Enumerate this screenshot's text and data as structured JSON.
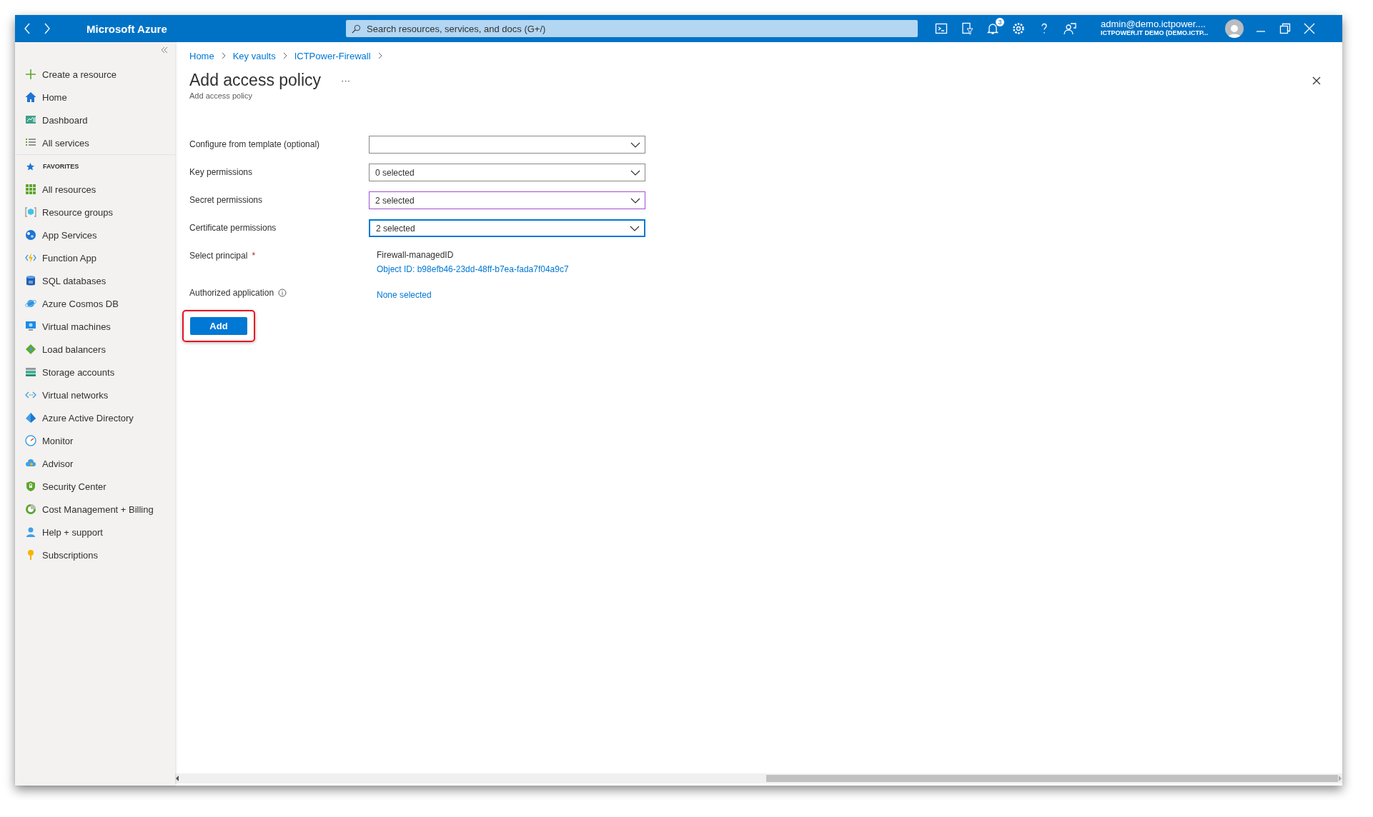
{
  "top_bar": {
    "brand": "Microsoft Azure",
    "search": {
      "placeholder": "Search resources, services, and docs (G+/)"
    },
    "notification_count": "3",
    "account": {
      "email": "admin@demo.ictpower....",
      "directory": "ICTPOWER.IT DEMO (DEMO.ICTP..."
    }
  },
  "sidebar": {
    "items": [
      {
        "kind": "plus",
        "label": "Create a resource"
      },
      {
        "kind": "home",
        "label": "Home"
      },
      {
        "kind": "dashboard",
        "label": "Dashboard"
      },
      {
        "kind": "list",
        "label": "All services"
      }
    ],
    "favorites_label": "FAVORITES",
    "favorites": [
      {
        "kind": "grid",
        "label": "All resources"
      },
      {
        "kind": "cube",
        "label": "Resource groups"
      },
      {
        "kind": "globe",
        "label": "App Services"
      },
      {
        "kind": "bolt",
        "label": "Function App"
      },
      {
        "kind": "sql",
        "label": "SQL databases"
      },
      {
        "kind": "planet",
        "label": "Azure Cosmos DB"
      },
      {
        "kind": "monitor",
        "label": "Virtual machines"
      },
      {
        "kind": "diamond",
        "label": "Load balancers"
      },
      {
        "kind": "storage",
        "label": "Storage accounts"
      },
      {
        "kind": "code",
        "label": "Virtual networks"
      },
      {
        "kind": "pyramid",
        "label": "Azure Active Directory"
      },
      {
        "kind": "gauge",
        "label": "Monitor"
      },
      {
        "kind": "cloud",
        "label": "Advisor"
      },
      {
        "kind": "shield",
        "label": "Security Center"
      },
      {
        "kind": "coin",
        "label": "Cost Management + Billing"
      },
      {
        "kind": "person",
        "label": "Help + support"
      },
      {
        "kind": "key",
        "label": "Subscriptions"
      }
    ]
  },
  "breadcrumb": [
    "Home",
    "Key vaults",
    "ICTPower-Firewall"
  ],
  "title": "Add access policy",
  "more_button": "···",
  "subtitle": "Add access policy",
  "form": [
    {
      "kind": "dropdown",
      "label": "Configure from template (optional)",
      "hovered": false,
      "focused": false
    },
    {
      "kind": "dropdown",
      "label": "Key permissions",
      "value": "0 selected",
      "hovered": false,
      "focused": false
    },
    {
      "kind": "dropdown",
      "label": "Secret permissions",
      "value": "2 selected",
      "hovered": true,
      "focused": false
    },
    {
      "kind": "dropdown",
      "label": "Certificate permissions",
      "value": "2 selected",
      "hovered": false,
      "focused": true
    },
    {
      "kind": "principal",
      "label": "Select principal",
      "required_mark": "*",
      "name": "Firewall-managedID",
      "object_id": "Object ID: b98efb46-23dd-48ff-b7ea-fada7f04a9c7"
    },
    {
      "kind": "link",
      "label": "Authorized application",
      "info": true,
      "value": "None selected"
    }
  ],
  "add_button": {
    "label": "Add",
    "highlighted": true
  }
}
